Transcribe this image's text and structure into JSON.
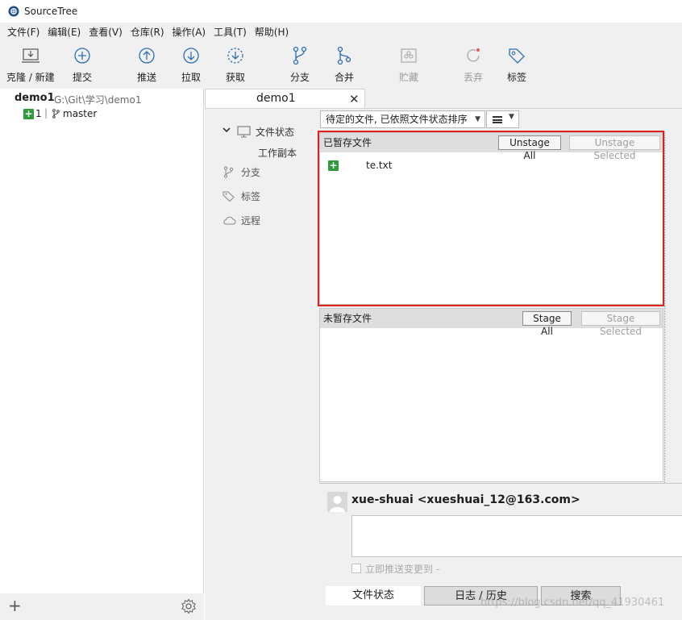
{
  "window": {
    "title": "SourceTree"
  },
  "menu": [
    "文件(F)",
    "编辑(E)",
    "查看(V)",
    "仓库(R)",
    "操作(A)",
    "工具(T)",
    "帮助(H)"
  ],
  "toolbar": {
    "clone": "克隆 / 新建",
    "commit": "提交",
    "push": "推送",
    "pull": "拉取",
    "fetch": "获取",
    "branch": "分支",
    "merge": "合并",
    "stash": "贮藏",
    "discard": "丢弃",
    "tag": "标签"
  },
  "sidebar": {
    "repo_name": "demo1",
    "repo_path": "G:\\Git\\学习\\demo1",
    "badge": "+",
    "changes_count": "1",
    "separator": "|",
    "branch": "master"
  },
  "tab": {
    "title": "demo1",
    "close": "✕"
  },
  "nav": {
    "file_status": "文件状态",
    "working_copy": "工作副本",
    "branches": "分支",
    "tags": "标签",
    "remotes": "远程"
  },
  "sort_dropdown": {
    "value": "待定的文件, 已依照文件状态排序"
  },
  "staged": {
    "title": "已暂存文件",
    "unstage_all": "Unstage All",
    "unstage_selected": "Unstage Selected",
    "files": [
      {
        "status": "+",
        "name": "te.txt"
      }
    ]
  },
  "unstaged": {
    "title": "未暂存文件",
    "stage_all": "Stage All",
    "stage_selected": "Stage Selected"
  },
  "commit": {
    "author": "xue-shuai <xueshuai_12@163.com>",
    "push_immediately": "立即推送变更到 -"
  },
  "bottom_tabs": {
    "file_status": "文件状态",
    "log_history": "日志 / 历史",
    "search": "搜索"
  },
  "watermark": "https://blog.csdn.net/qq_41930461"
}
